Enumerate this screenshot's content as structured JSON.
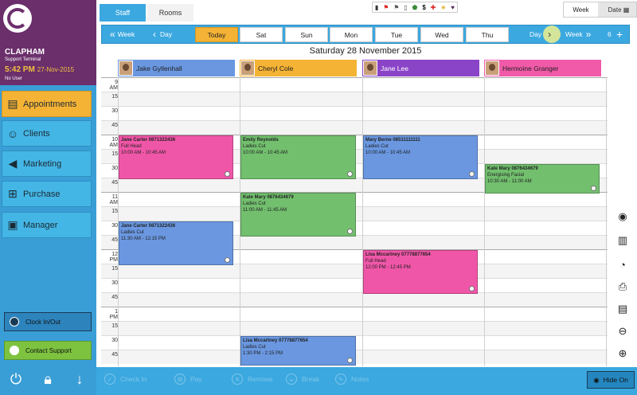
{
  "branch": {
    "location": "CLAPHAM",
    "terminal": "Support Terminal",
    "time": "5:42 PM",
    "date": "27-Nov-2015",
    "user": "No User"
  },
  "nav": [
    {
      "label": "Appointments",
      "icon": "appointments-icon",
      "active": true
    },
    {
      "label": "Clients",
      "icon": "clients-icon",
      "active": false
    },
    {
      "label": "Marketing",
      "icon": "megaphone-icon",
      "active": false
    },
    {
      "label": "Purchase",
      "icon": "cart-icon",
      "active": false
    },
    {
      "label": "Manager",
      "icon": "briefcase-icon",
      "active": false
    }
  ],
  "clock_label": "Clock In/Out",
  "support_label": "Contact Support",
  "tabs": {
    "staff": "Staff",
    "rooms": "Rooms"
  },
  "legend": [
    "$"
  ],
  "view": {
    "week": "Week",
    "date": "Date"
  },
  "navstrip": {
    "prev_week": "Week",
    "prev_day": "Day",
    "days": [
      "Today",
      "Sat",
      "Sun",
      "Mon",
      "Tue",
      "Wed",
      "Thu"
    ],
    "next_day": "Day",
    "next_week": "Week",
    "count": "6",
    "plus": "+"
  },
  "date_title": "Saturday 28 November 2015",
  "staff": [
    {
      "name": "Jake Gyllenhall",
      "color": "#6a97e0"
    },
    {
      "name": "Cheryl Cole",
      "color": "#f5b335"
    },
    {
      "name": "Jane Lee",
      "color": "#8a44c8"
    },
    {
      "name": "Hermoine Granger",
      "color": "#f05aa8"
    }
  ],
  "rows": [
    "9 AM",
    "15",
    "30",
    "45",
    "10 AM",
    "15",
    "30",
    "45",
    "11 AM",
    "15",
    "30",
    "45",
    "12 PM",
    "15",
    "30",
    "45",
    "1 PM",
    "15",
    "30",
    "45"
  ],
  "appointments": [
    {
      "col": 0,
      "start": 4,
      "span": 3,
      "color": "#f056a8",
      "title": "Jane Carter 0871322436",
      "service": "Full Head",
      "time": "10:00 AM - 10:45 AM"
    },
    {
      "col": 1,
      "start": 4,
      "span": 3,
      "color": "#72bf6e",
      "title": "Emily Reynolds",
      "service": "Ladies Cut",
      "time": "10:00 AM - 10:45 AM"
    },
    {
      "col": 2,
      "start": 4,
      "span": 3,
      "color": "#6a97e0",
      "title": "Mary Berne 08511111111",
      "service": "Ladies Cut",
      "time": "10:00 AM - 10:45 AM"
    },
    {
      "col": 3,
      "start": 6,
      "span": 2,
      "color": "#72bf6e",
      "title": "Kate Mary 0876434679",
      "service": "Energising Facial",
      "time": "10:30 AM - 11:00 AM"
    },
    {
      "col": 1,
      "start": 8,
      "span": 3,
      "color": "#72bf6e",
      "title": "Kate Mary 0876434679",
      "service": "Ladies Cut",
      "time": "11:00 AM - 11:45 AM"
    },
    {
      "col": 0,
      "start": 10,
      "span": 3,
      "color": "#6a97e0",
      "title": "Jane Carter 0871322436",
      "service": "Ladies Cut",
      "time": "11:30 AM - 12:15 PM"
    },
    {
      "col": 2,
      "start": 12,
      "span": 3,
      "color": "#f056a8",
      "title": "Lisa Mccartney 07778877654",
      "service": "Full Head",
      "time": "12:00 PM - 12:45 PM"
    },
    {
      "col": 1,
      "start": 18,
      "span": 2,
      "color": "#6a97e0",
      "title": "Lisa Mccartney 07778877654",
      "service": "Ladies Cut",
      "time": "1:30 PM - 2:15 PM"
    }
  ],
  "right_icons": [
    "eye-icon",
    "invoice-icon",
    "clock-icon",
    "printer-icon",
    "notes-icon",
    "zoom-out-icon",
    "zoom-in-icon"
  ],
  "bottom": {
    "checkin": "Check In",
    "pay": "Pay",
    "remove": "Remove",
    "break": "Break",
    "notes": "Notes",
    "hide_on": "Hide On"
  }
}
